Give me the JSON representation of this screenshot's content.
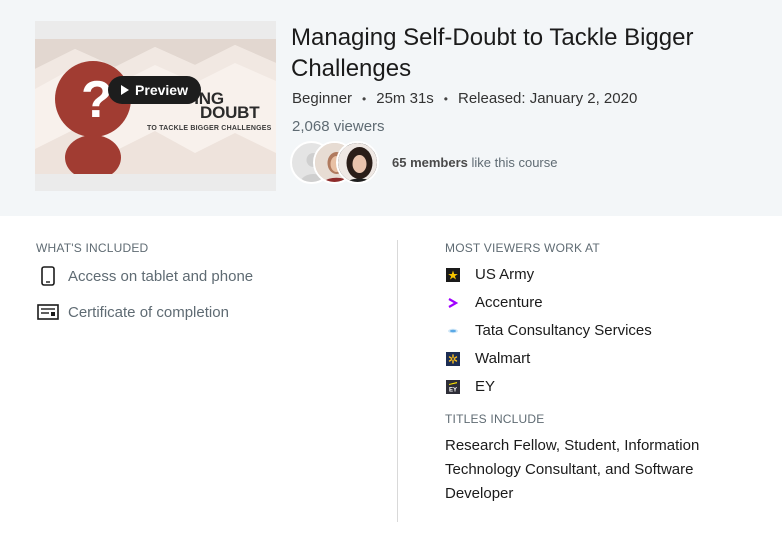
{
  "course": {
    "title": "Managing Self-Doubt to Tackle Bigger Challenges",
    "level": "Beginner",
    "duration": "25m 31s",
    "released": "Released: January 2, 2020",
    "viewers": "2,068 viewers",
    "members_count": "65 members",
    "members_suffix": " like this course"
  },
  "thumbnail": {
    "line1": "MANAGING",
    "line2": "DOUBT",
    "line3": "TO TACKLE BIGGER CHALLENGES",
    "preview_label": "Preview"
  },
  "included": {
    "heading": "WHAT'S INCLUDED",
    "items": [
      {
        "icon": "phone-icon",
        "label": "Access on tablet and phone"
      },
      {
        "icon": "certificate-icon",
        "label": "Certificate of completion"
      }
    ]
  },
  "employers": {
    "heading": "MOST VIEWERS WORK AT",
    "items": [
      {
        "icon": "us-army-logo-icon",
        "name": "US Army",
        "color": "#1a1a1a"
      },
      {
        "icon": "accenture-logo-icon",
        "name": "Accenture",
        "color": "#a100ff"
      },
      {
        "icon": "tcs-logo-icon",
        "name": "Tata Consultancy Services",
        "color": "#5aa9e6"
      },
      {
        "icon": "walmart-logo-icon",
        "name": "Walmart",
        "color": "#1c2d53"
      },
      {
        "icon": "ey-logo-icon",
        "name": "EY",
        "color": "#2e2e38"
      }
    ]
  },
  "titles": {
    "heading": "TITLES INCLUDE",
    "text": "Research Fellow, Student, Information Technology Consultant, and Software Developer"
  }
}
